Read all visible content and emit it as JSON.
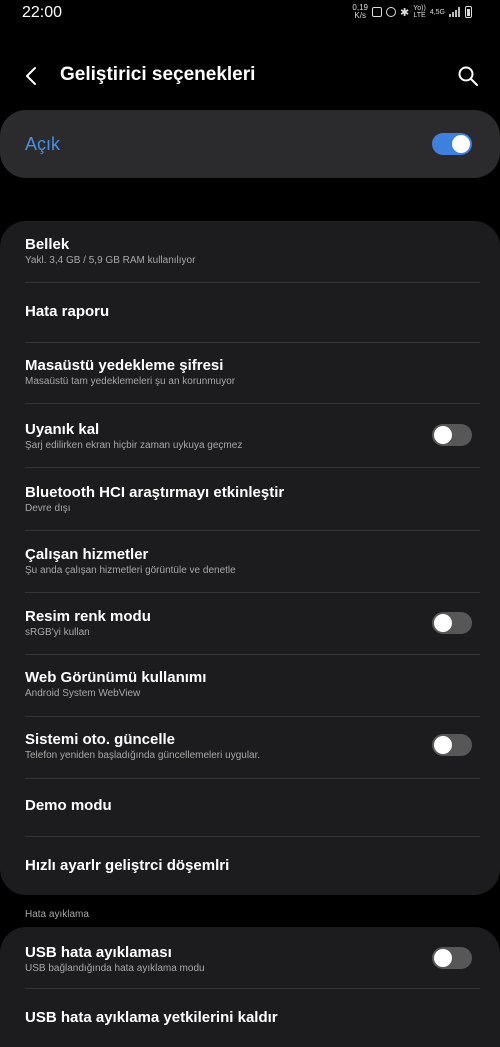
{
  "status_bar": {
    "time": "22:00",
    "net_speed_value": "0,19",
    "net_speed_unit": "K/s",
    "network_top": "Yo))",
    "network_bottom": "LTE",
    "network_gen": "4,5G"
  },
  "app_bar": {
    "title": "Geliştirici seçenekleri",
    "back_icon": "chevron-left-icon",
    "search_icon": "search-icon"
  },
  "master_switch": {
    "label": "Açık",
    "checked": true,
    "accent": "#3d80e0"
  },
  "settings": [
    {
      "title": "Bellek",
      "subtitle": "Yakl. 3,4 GB / 5,9 GB RAM kullanılıyor"
    },
    {
      "title": "Hata raporu"
    },
    {
      "title": "Masaüstü yedekleme şifresi",
      "subtitle": "Masaüstü tam yedeklemeleri şu an korunmuyor"
    },
    {
      "title": "Uyanık kal",
      "subtitle": "Şarj edilirken ekran hiçbir zaman uykuya geçmez",
      "toggle": false
    },
    {
      "title": "Bluetooth HCI araştırmayı etkinleştir",
      "subtitle": "Devre dışı"
    },
    {
      "title": "Çalışan hizmetler",
      "subtitle": "Şu anda çalışan hizmetleri görüntüle ve denetle"
    },
    {
      "title": "Resim renk modu",
      "subtitle": "sRGB'yi kullan",
      "toggle": false
    },
    {
      "title": "Web Görünümü kullanımı",
      "subtitle": "Android System WebView"
    },
    {
      "title": "Sistemi oto. güncelle",
      "subtitle": "Telefon yeniden başladığında güncellemeleri uygular.",
      "toggle": false
    },
    {
      "title": "Demo modu"
    },
    {
      "title": "Hızlı ayarlr geliştrci döşemlri"
    }
  ],
  "debug_section": {
    "header": "Hata ayıklama",
    "items": [
      {
        "title": "USB hata ayıklaması",
        "subtitle": "USB bağlandığında hata ayıklama modu",
        "toggle": false
      },
      {
        "title": "USB hata ayıklama yetkilerini kaldır"
      }
    ]
  }
}
